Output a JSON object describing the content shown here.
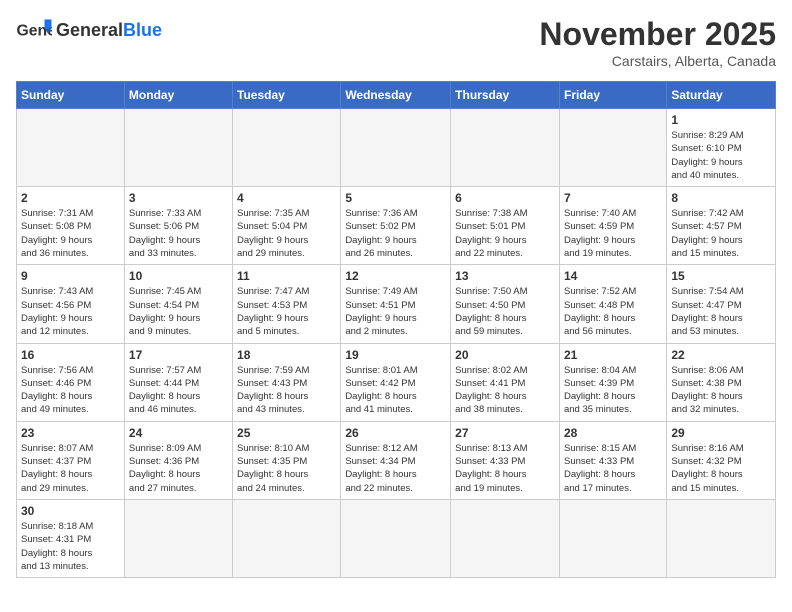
{
  "header": {
    "logo_general": "General",
    "logo_blue": "Blue",
    "month": "November 2025",
    "location": "Carstairs, Alberta, Canada"
  },
  "weekdays": [
    "Sunday",
    "Monday",
    "Tuesday",
    "Wednesday",
    "Thursday",
    "Friday",
    "Saturday"
  ],
  "weeks": [
    [
      {
        "day": "",
        "info": ""
      },
      {
        "day": "",
        "info": ""
      },
      {
        "day": "",
        "info": ""
      },
      {
        "day": "",
        "info": ""
      },
      {
        "day": "",
        "info": ""
      },
      {
        "day": "",
        "info": ""
      },
      {
        "day": "1",
        "info": "Sunrise: 8:29 AM\nSunset: 6:10 PM\nDaylight: 9 hours\nand 40 minutes."
      }
    ],
    [
      {
        "day": "2",
        "info": "Sunrise: 7:31 AM\nSunset: 5:08 PM\nDaylight: 9 hours\nand 36 minutes."
      },
      {
        "day": "3",
        "info": "Sunrise: 7:33 AM\nSunset: 5:06 PM\nDaylight: 9 hours\nand 33 minutes."
      },
      {
        "day": "4",
        "info": "Sunrise: 7:35 AM\nSunset: 5:04 PM\nDaylight: 9 hours\nand 29 minutes."
      },
      {
        "day": "5",
        "info": "Sunrise: 7:36 AM\nSunset: 5:02 PM\nDaylight: 9 hours\nand 26 minutes."
      },
      {
        "day": "6",
        "info": "Sunrise: 7:38 AM\nSunset: 5:01 PM\nDaylight: 9 hours\nand 22 minutes."
      },
      {
        "day": "7",
        "info": "Sunrise: 7:40 AM\nSunset: 4:59 PM\nDaylight: 9 hours\nand 19 minutes."
      },
      {
        "day": "8",
        "info": "Sunrise: 7:42 AM\nSunset: 4:57 PM\nDaylight: 9 hours\nand 15 minutes."
      }
    ],
    [
      {
        "day": "9",
        "info": "Sunrise: 7:43 AM\nSunset: 4:56 PM\nDaylight: 9 hours\nand 12 minutes."
      },
      {
        "day": "10",
        "info": "Sunrise: 7:45 AM\nSunset: 4:54 PM\nDaylight: 9 hours\nand 9 minutes."
      },
      {
        "day": "11",
        "info": "Sunrise: 7:47 AM\nSunset: 4:53 PM\nDaylight: 9 hours\nand 5 minutes."
      },
      {
        "day": "12",
        "info": "Sunrise: 7:49 AM\nSunset: 4:51 PM\nDaylight: 9 hours\nand 2 minutes."
      },
      {
        "day": "13",
        "info": "Sunrise: 7:50 AM\nSunset: 4:50 PM\nDaylight: 8 hours\nand 59 minutes."
      },
      {
        "day": "14",
        "info": "Sunrise: 7:52 AM\nSunset: 4:48 PM\nDaylight: 8 hours\nand 56 minutes."
      },
      {
        "day": "15",
        "info": "Sunrise: 7:54 AM\nSunset: 4:47 PM\nDaylight: 8 hours\nand 53 minutes."
      }
    ],
    [
      {
        "day": "16",
        "info": "Sunrise: 7:56 AM\nSunset: 4:46 PM\nDaylight: 8 hours\nand 49 minutes."
      },
      {
        "day": "17",
        "info": "Sunrise: 7:57 AM\nSunset: 4:44 PM\nDaylight: 8 hours\nand 46 minutes."
      },
      {
        "day": "18",
        "info": "Sunrise: 7:59 AM\nSunset: 4:43 PM\nDaylight: 8 hours\nand 43 minutes."
      },
      {
        "day": "19",
        "info": "Sunrise: 8:01 AM\nSunset: 4:42 PM\nDaylight: 8 hours\nand 41 minutes."
      },
      {
        "day": "20",
        "info": "Sunrise: 8:02 AM\nSunset: 4:41 PM\nDaylight: 8 hours\nand 38 minutes."
      },
      {
        "day": "21",
        "info": "Sunrise: 8:04 AM\nSunset: 4:39 PM\nDaylight: 8 hours\nand 35 minutes."
      },
      {
        "day": "22",
        "info": "Sunrise: 8:06 AM\nSunset: 4:38 PM\nDaylight: 8 hours\nand 32 minutes."
      }
    ],
    [
      {
        "day": "23",
        "info": "Sunrise: 8:07 AM\nSunset: 4:37 PM\nDaylight: 8 hours\nand 29 minutes."
      },
      {
        "day": "24",
        "info": "Sunrise: 8:09 AM\nSunset: 4:36 PM\nDaylight: 8 hours\nand 27 minutes."
      },
      {
        "day": "25",
        "info": "Sunrise: 8:10 AM\nSunset: 4:35 PM\nDaylight: 8 hours\nand 24 minutes."
      },
      {
        "day": "26",
        "info": "Sunrise: 8:12 AM\nSunset: 4:34 PM\nDaylight: 8 hours\nand 22 minutes."
      },
      {
        "day": "27",
        "info": "Sunrise: 8:13 AM\nSunset: 4:33 PM\nDaylight: 8 hours\nand 19 minutes."
      },
      {
        "day": "28",
        "info": "Sunrise: 8:15 AM\nSunset: 4:33 PM\nDaylight: 8 hours\nand 17 minutes."
      },
      {
        "day": "29",
        "info": "Sunrise: 8:16 AM\nSunset: 4:32 PM\nDaylight: 8 hours\nand 15 minutes."
      }
    ],
    [
      {
        "day": "30",
        "info": "Sunrise: 8:18 AM\nSunset: 4:31 PM\nDaylight: 8 hours\nand 13 minutes."
      },
      {
        "day": "",
        "info": ""
      },
      {
        "day": "",
        "info": ""
      },
      {
        "day": "",
        "info": ""
      },
      {
        "day": "",
        "info": ""
      },
      {
        "day": "",
        "info": ""
      },
      {
        "day": "",
        "info": ""
      }
    ]
  ]
}
